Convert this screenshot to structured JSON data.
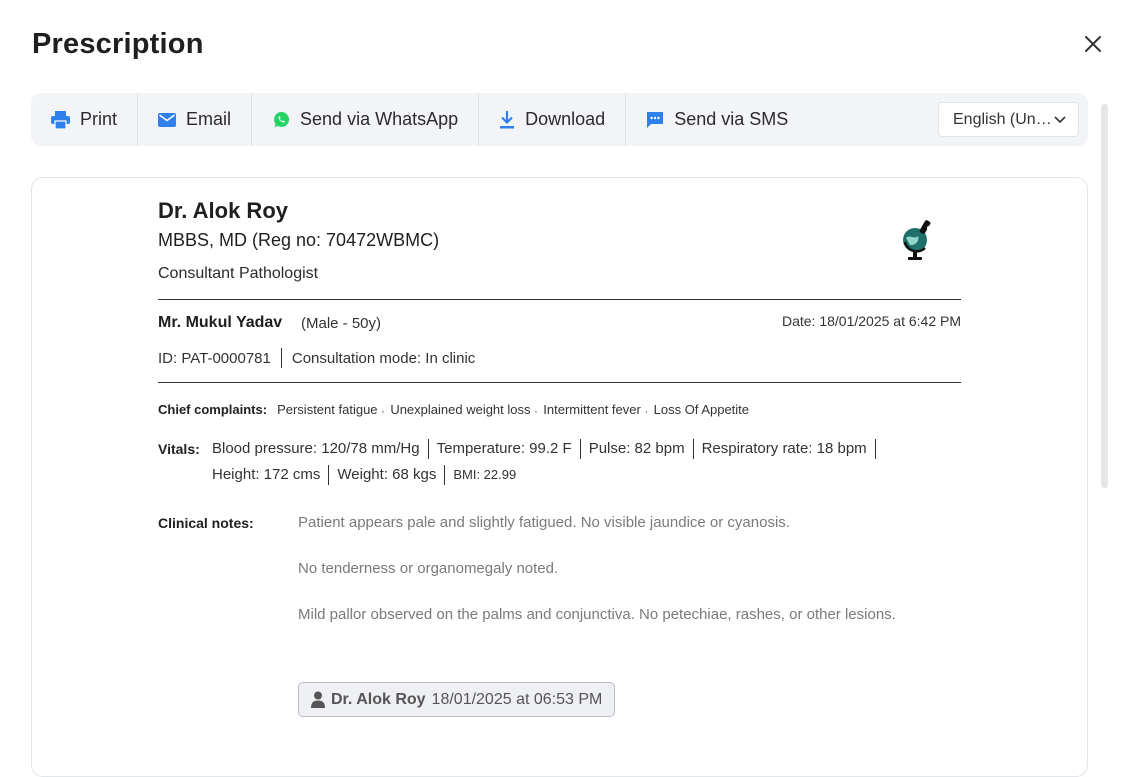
{
  "dialog": {
    "title": "Prescription"
  },
  "toolbar": {
    "print": "Print",
    "email": "Email",
    "whatsapp": "Send via WhatsApp",
    "download": "Download",
    "sms": "Send via SMS",
    "language": "English (United States)"
  },
  "doctor": {
    "name": "Dr. Alok Roy",
    "degree": "MBBS, MD (Reg no: 70472WBMC)",
    "role": "Consultant Pathologist"
  },
  "patient": {
    "name": "Mr. Mukul Yadav",
    "meta": "(Male - 50y)",
    "date": "Date: 18/01/2025 at 6:42 PM",
    "id": "ID: PAT-0000781",
    "mode": "Consultation mode: In clinic"
  },
  "complaints": {
    "label": "Chief complaints:",
    "items": [
      "Persistent fatigue",
      "Unexplained weight loss",
      "Intermittent fever",
      "Loss Of Appetite"
    ]
  },
  "vitals": {
    "label": "Vitals:",
    "bp": "Blood pressure: 120/78 mm/Hg",
    "temp": "Temperature: 99.2 F",
    "pulse": "Pulse: 82 bpm",
    "resp": "Respiratory rate: 18 bpm",
    "height": "Height: 172 cms",
    "weight": "Weight: 68 kgs",
    "bmi": "BMI: 22.99"
  },
  "clinical_notes": {
    "label": "Clinical notes:",
    "notes": [
      "Patient appears pale and slightly fatigued. No visible jaundice or cyanosis.",
      "No tenderness or organomegaly noted.",
      "Mild pallor observed on the palms and conjunctiva. No petechiae, rashes, or other lesions."
    ],
    "author": "Dr. Alok Roy",
    "timestamp": "18/01/2025 at 06:53 PM"
  },
  "colors": {
    "accent": "#2f80ed",
    "whatsapp": "#25d366",
    "logo": "#1f6f6a"
  }
}
